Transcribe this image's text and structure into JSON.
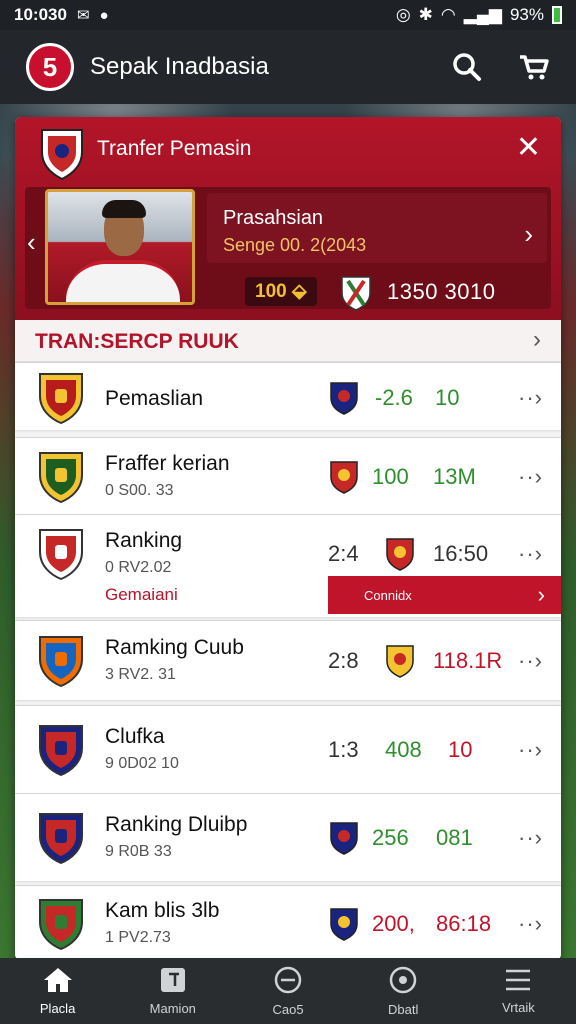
{
  "status": {
    "time": "10:030",
    "battery": "93%"
  },
  "appbar": {
    "title": "Sepak Inadbasia",
    "logo_text": "5"
  },
  "hero": {
    "title": "Tranfer Pemasin",
    "player_name": "Prasahsian",
    "player_date": "Senge 00. 2(2043",
    "pill": "100 ⬙",
    "score": "1350 3010"
  },
  "section": {
    "title": "TRAN:SERCP RUUK"
  },
  "rows": [
    {
      "name": "Pemaslian",
      "sub": "",
      "tag": "",
      "v1": "-2.6",
      "v2": "10",
      "v1_color": "#2f8f2f",
      "v2_color": "#2f8f2f",
      "crest_colors": [
        "#b71c1c",
        "#f4c430"
      ],
      "badge_colors": [
        "#1a237e",
        "#c62828"
      ]
    },
    {
      "name": "Fraffer kerian",
      "sub": "0 S00. 33",
      "tag": "",
      "v1": "100",
      "v2": "13M",
      "v1_color": "#2f8f2f",
      "v2_color": "#2f8f2f",
      "crest_colors": [
        "#1b5e20",
        "#f4c430"
      ],
      "badge_colors": [
        "#c62828",
        "#f4c430"
      ]
    },
    {
      "name": "Ranking",
      "sub": "0 RV2.02",
      "tag": "Gemaiani",
      "v1": "2:4",
      "v2": "16:50",
      "v1_color": "#333333",
      "v2_color": "#333333",
      "crest_colors": [
        "#c62828",
        "#ffffff"
      ],
      "badge_colors": [
        "#c62828",
        "#f4c430"
      ]
    },
    {
      "name": "Ramking Cuub",
      "sub": "3 RV2. 31",
      "tag": "",
      "v1": "2:8",
      "v2": "118.1R",
      "v1_color": "#333333",
      "v2_color": "#c0142a",
      "crest_colors": [
        "#1565c0",
        "#ef6c00"
      ],
      "badge_colors": [
        "#f4c430",
        "#c62828"
      ]
    },
    {
      "name": "Clufka",
      "sub": "9 0D02 10",
      "tag": "",
      "v1": "1:3",
      "v1b": "408",
      "v2": "10",
      "v1_color": "#333333",
      "v1b_color": "#2f8f2f",
      "v2_color": "#c0142a",
      "crest_colors": [
        "#c62828",
        "#1a237e"
      ],
      "badge_colors": []
    },
    {
      "name": "Ranking Dluibp",
      "sub": "9 R0B 33",
      "tag": "",
      "v1": "256",
      "v2": "081",
      "v1_color": "#2f8f2f",
      "v2_color": "#2f8f2f",
      "crest_colors": [
        "#c62828",
        "#1a237e"
      ],
      "badge_colors": [
        "#1a237e",
        "#c62828"
      ]
    },
    {
      "name": "Kam blis 3lb",
      "sub": "1 PV2.73",
      "tag": "",
      "v1": "200,",
      "v2": "86:18",
      "v1_color": "#c0142a",
      "v2_color": "#c0142a",
      "crest_colors": [
        "#c62828",
        "#2e7d32"
      ],
      "badge_colors": [
        "#1a237e",
        "#f4c430"
      ]
    }
  ],
  "follow_button": {
    "label": "Connidx"
  },
  "nav": [
    {
      "label": "Placla",
      "icon": "home-icon"
    },
    {
      "label": "Mamion",
      "icon": "note-icon"
    },
    {
      "label": "Cao5",
      "icon": "minus-circle-icon"
    },
    {
      "label": "Dbatl",
      "icon": "ball-icon"
    },
    {
      "label": "Vrtaik",
      "icon": "menu-icon"
    }
  ]
}
